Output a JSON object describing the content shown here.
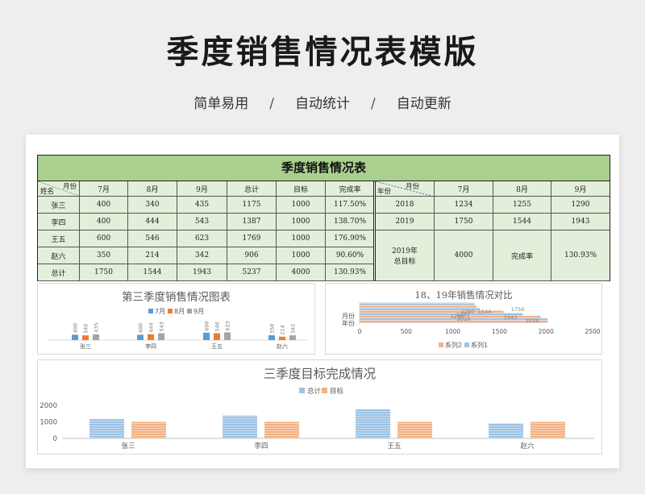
{
  "header": {
    "title": "季度销售情况表模版",
    "subtitle_items": [
      "简单易用",
      "自动统计",
      "自动更新"
    ],
    "separator": "/"
  },
  "table": {
    "title": "季度销售情况表",
    "corner_top": "月份",
    "corner_bottom": "姓名",
    "columns": [
      "7月",
      "8月",
      "9月",
      "总计",
      "目标",
      "完成率"
    ],
    "rows": [
      {
        "name": "张三",
        "values": [
          "400",
          "340",
          "435",
          "1175",
          "1000",
          "117.50%"
        ]
      },
      {
        "name": "李四",
        "values": [
          "400",
          "444",
          "543",
          "1387",
          "1000",
          "138.70%"
        ]
      },
      {
        "name": "王五",
        "values": [
          "600",
          "546",
          "623",
          "1769",
          "1000",
          "176.90%"
        ]
      },
      {
        "name": "赵六",
        "values": [
          "350",
          "214",
          "342",
          "906",
          "1000",
          "90.60%"
        ]
      },
      {
        "name": "总计",
        "values": [
          "1750",
          "1544",
          "1943",
          "5237",
          "4000",
          "130.93%"
        ]
      }
    ],
    "right": {
      "corner_top": "月份",
      "corner_bottom": "年份",
      "columns": [
        "7月",
        "8月",
        "9月"
      ],
      "rows": [
        {
          "label": "2018",
          "values": [
            "1234",
            "1255",
            "1290"
          ]
        },
        {
          "label": "2019",
          "values": [
            "1750",
            "1544",
            "1943"
          ]
        }
      ],
      "summary": {
        "label": "2019年\n总目标",
        "target": "4000",
        "rate_label": "完成率",
        "rate": "130.93%"
      }
    }
  },
  "chart_data": [
    {
      "type": "bar",
      "title": "第三季度销售情况图表",
      "categories": [
        "张三",
        "李四",
        "王五",
        "赵六"
      ],
      "series": [
        {
          "name": "7月",
          "values": [
            400,
            400,
            600,
            350
          ],
          "color": "#5b9bd5"
        },
        {
          "name": "8月",
          "values": [
            340,
            444,
            546,
            214
          ],
          "color": "#ed7d31"
        },
        {
          "name": "9月",
          "values": [
            435,
            543,
            623,
            342
          ],
          "color": "#a5a5a5"
        }
      ],
      "legend": "top"
    },
    {
      "type": "bar",
      "orientation": "horizontal",
      "title": "18、19年销售情况对比",
      "categories": [
        "年份",
        "月份"
      ],
      "xlim": [
        0,
        2500
      ],
      "xticks": [
        "0",
        "500",
        "1000",
        "1500",
        "2000",
        "2500"
      ],
      "series": [
        {
          "name": "系列1",
          "values": [
            2018,
            0
          ],
          "color": "#9dc3e6"
        },
        {
          "name": "系列2",
          "values": [
            2019,
            0
          ],
          "color": "#f4b183"
        }
      ],
      "overlay_labels": [
        "1290",
        "1544",
        "1255",
        "1750",
        "1234",
        "1943",
        "2018",
        "2019"
      ],
      "legend": "bottom",
      "legend_order": [
        "系列2",
        "系列1"
      ]
    },
    {
      "type": "bar",
      "title": "三季度目标完成情况",
      "categories": [
        "张三",
        "李四",
        "王五",
        "赵六"
      ],
      "yticks": [
        "2000",
        "1000",
        "0"
      ],
      "ylim": [
        0,
        2000
      ],
      "series": [
        {
          "name": "总计",
          "values": [
            1175,
            1387,
            1769,
            906
          ],
          "color": "#9dc3e6"
        },
        {
          "name": "目标",
          "values": [
            1000,
            1000,
            1000,
            1000
          ],
          "color": "#f4b183"
        }
      ],
      "legend": "top"
    }
  ]
}
